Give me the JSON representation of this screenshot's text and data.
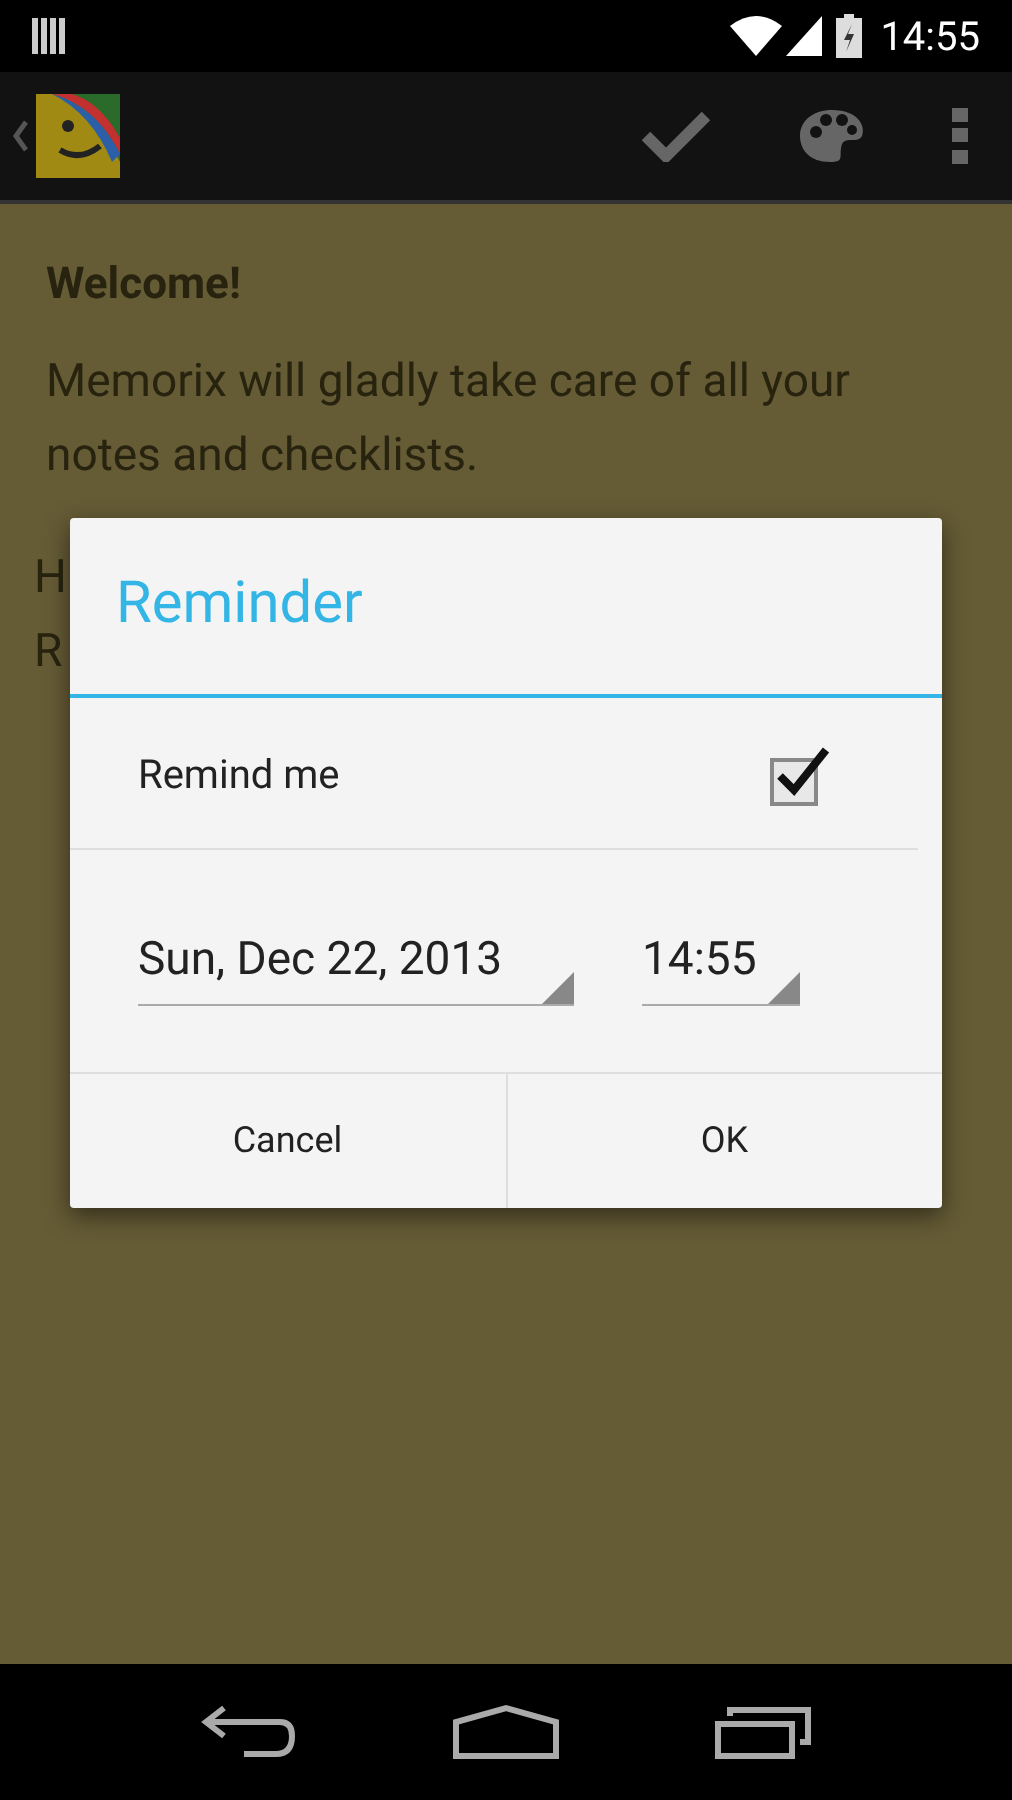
{
  "status_bar": {
    "time": "14:55"
  },
  "note": {
    "title": "Welcome!",
    "body": "Memorix will gladly take care of all your notes and checklists.",
    "hidden_lines": [
      "H",
      "R"
    ]
  },
  "dialog": {
    "title": "Reminder",
    "remind_me": {
      "label": "Remind me",
      "checked": true
    },
    "date": "Sun, Dec 22, 2013",
    "time": "14:55",
    "buttons": [
      "Cancel",
      "OK"
    ]
  }
}
